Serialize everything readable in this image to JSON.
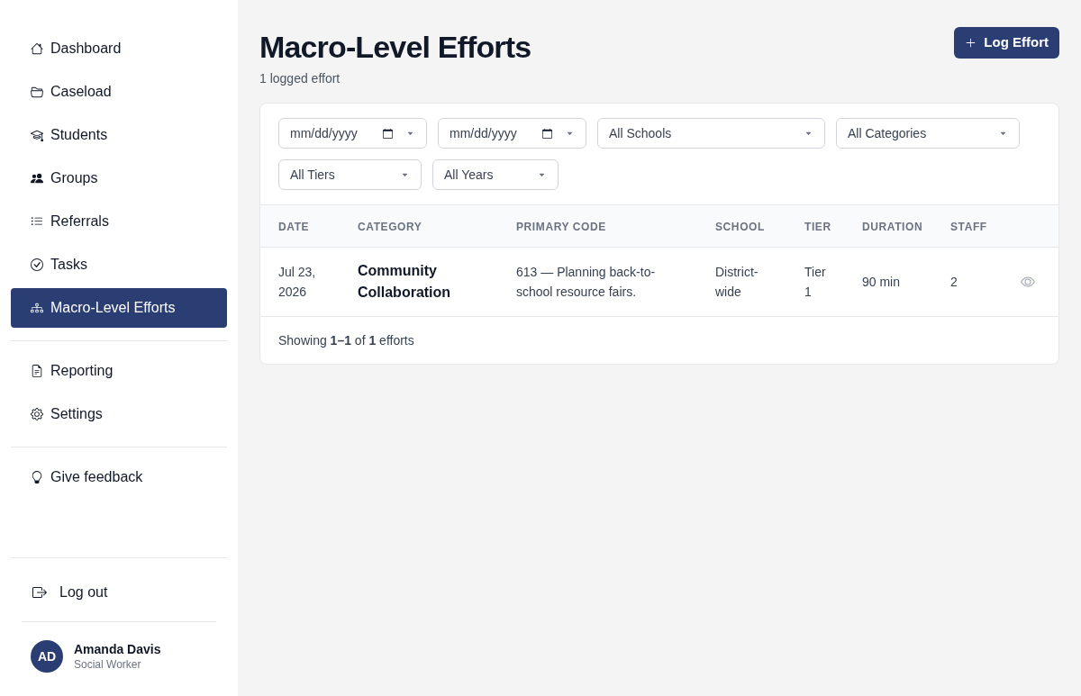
{
  "sidebar": {
    "sections": [
      {
        "items": [
          {
            "label": "Dashboard",
            "selected": false
          },
          {
            "label": "Caseload",
            "selected": false
          },
          {
            "label": "Students",
            "selected": false
          },
          {
            "label": "Groups",
            "selected": false
          },
          {
            "label": "Referrals",
            "selected": false
          },
          {
            "label": "Tasks",
            "selected": false
          },
          {
            "label": "Macro-Level Efforts",
            "selected": true
          }
        ]
      },
      {
        "items": [
          {
            "label": "Reporting",
            "selected": false
          },
          {
            "label": "Settings",
            "selected": false
          }
        ]
      },
      {
        "items": [
          {
            "label": "Give feedback",
            "selected": false
          }
        ]
      }
    ],
    "logout": {
      "label": "Log out"
    },
    "user": {
      "initials": "AD",
      "name": "Amanda Davis",
      "role": "Social Worker"
    }
  },
  "header": {
    "title": "Macro-Level Efforts",
    "subtitle": "1 logged effort",
    "action_button": {
      "label": "Log Effort"
    }
  },
  "filters": [
    {
      "kind": "date",
      "placeholder": "mm/dd/yyyy"
    },
    {
      "kind": "date",
      "placeholder": "mm/dd/yyyy"
    },
    {
      "kind": "select",
      "value": "All Schools"
    },
    {
      "kind": "select",
      "value": "All Categories"
    },
    {
      "kind": "select",
      "value": "All Tiers"
    },
    {
      "kind": "select",
      "value": "All Years"
    }
  ],
  "table": {
    "columns": [
      "DATE",
      "CATEGORY",
      "PRIMARY CODE",
      "SCHOOL",
      "TIER",
      "DURATION",
      "STAFF"
    ],
    "rows": [
      {
        "cells": [
          "Jul 23, 2026",
          "Community Collaboration",
          "613 — Planning back-to-school resource fairs.",
          "District-wide",
          "Tier 1",
          "90 min",
          "2"
        ]
      }
    ],
    "footer": "Showing **1–1** of **1** efforts"
  }
}
